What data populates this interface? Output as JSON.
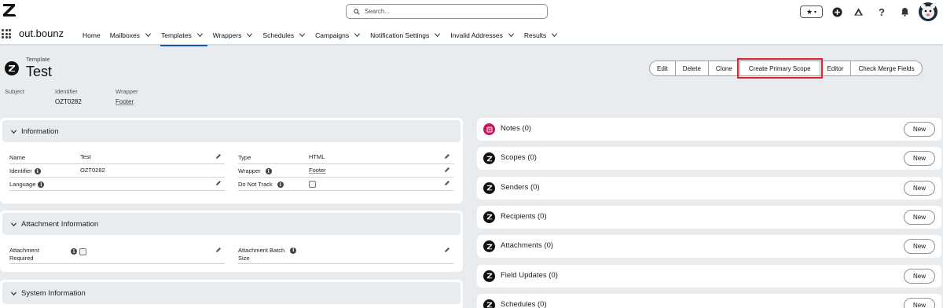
{
  "search": {
    "placeholder": "Search..."
  },
  "app": {
    "name": "out.bounz"
  },
  "nav": [
    {
      "label": "Home",
      "chevron": false,
      "active": false
    },
    {
      "label": "Mailboxes",
      "chevron": true,
      "active": false
    },
    {
      "label": "Templates",
      "chevron": true,
      "active": true
    },
    {
      "label": "Wrappers",
      "chevron": true,
      "active": false
    },
    {
      "label": "Schedules",
      "chevron": true,
      "active": false
    },
    {
      "label": "Campaigns",
      "chevron": true,
      "active": false
    },
    {
      "label": "Notification Settings",
      "chevron": true,
      "active": false
    },
    {
      "label": "Invalid Addresses",
      "chevron": true,
      "active": false
    },
    {
      "label": "Results",
      "chevron": true,
      "active": false
    }
  ],
  "record": {
    "object_type": "Template",
    "title": "Test",
    "highlights": {
      "subject_label": "Subject",
      "identifier_label": "Identifier",
      "identifier_value": "OZT0282",
      "wrapper_label": "Wrapper",
      "wrapper_value": "Footer"
    }
  },
  "actions": [
    "Edit",
    "Delete",
    "Clone",
    "Create Primary Scope",
    "Editor",
    "Check Merge Fields"
  ],
  "sections": {
    "information": "Information",
    "attachment": "Attachment Information",
    "system": "System Information"
  },
  "information": {
    "name_label": "Name",
    "name_value": "Test",
    "identifier_label": "Identifier",
    "identifier_value": "OZT0282",
    "language_label": "Language",
    "language_value": "",
    "type_label": "Type",
    "type_value": "HTML",
    "wrapper_label": "Wrapper",
    "wrapper_value": "Footer",
    "dnt_label": "Do Not Track",
    "dnt_checked": false
  },
  "attachment": {
    "required_label_1": "Attachment",
    "required_label_2": "Required",
    "batch_label_1": "Attachment Batch",
    "batch_label_2": "Size"
  },
  "related": [
    {
      "title": "Notes (0)",
      "icon": "notes-icon",
      "new_label": "New"
    },
    {
      "title": "Scopes (0)",
      "icon": "z-logo-icon",
      "new_label": "New"
    },
    {
      "title": "Senders (0)",
      "icon": "z-logo-icon",
      "new_label": "New"
    },
    {
      "title": "Recipients (0)",
      "icon": "z-logo-icon",
      "new_label": "New"
    },
    {
      "title": "Attachments (0)",
      "icon": "z-logo-icon",
      "new_label": "New"
    },
    {
      "title": "Field Updates (0)",
      "icon": "z-logo-icon",
      "new_label": "New"
    },
    {
      "title": "Schedules (0)",
      "icon": "z-logo-icon",
      "new_label": "New"
    }
  ],
  "colors": {
    "highlight_box": "#e0242c",
    "active_tab": "#0b5cab",
    "notes_icon": "#c2185b"
  }
}
